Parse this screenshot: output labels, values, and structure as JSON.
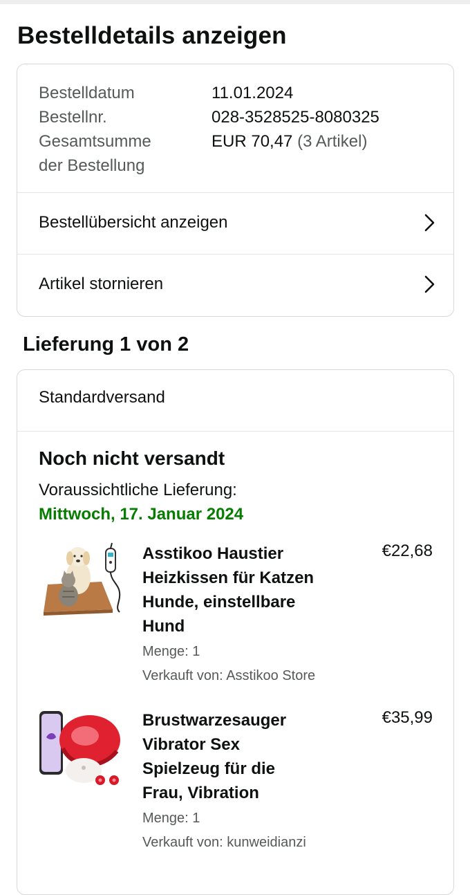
{
  "page": {
    "title": "Bestelldetails anzeigen"
  },
  "summary": {
    "date_label": "Bestelldatum",
    "date_value": "11.01.2024",
    "order_no_label": "Bestellnr.",
    "order_no_value": "028-3528525-8080325",
    "total_label_line1": "Gesamtsumme",
    "total_label_line2": "der Bestellung",
    "total_value": "EUR 70,47",
    "total_count": "(3 Artikel)"
  },
  "actions": [
    {
      "label": "Bestellübersicht anzeigen"
    },
    {
      "label": "Artikel stornieren"
    }
  ],
  "shipment": {
    "title": "Lieferung 1 von 2",
    "method": "Standardversand",
    "status": "Noch nicht versandt",
    "eta_label": "Voraussichtliche Lieferung:",
    "eta_date": "Mittwoch, 17. Januar 2024",
    "date_color": "#067d00",
    "items": [
      {
        "title_lines": [
          "Asstikoo Haustier",
          "Heizkissen für Katzen",
          "Hunde, einstellbare",
          "Hund"
        ],
        "price": "€22,68",
        "qty": "Menge: 1",
        "seller": "Verkauft von: Asstikoo Store",
        "image_icon": "pet-heating-pad-image"
      },
      {
        "title_lines": [
          "Brustwarzesauger",
          "Vibrator Sex",
          "Spielzeug für die",
          "Frau, Vibration"
        ],
        "price": "€35,99",
        "qty": "Menge: 1",
        "seller": "Verkauft von: kunweidianzi",
        "image_icon": "red-device-product-image"
      }
    ]
  }
}
